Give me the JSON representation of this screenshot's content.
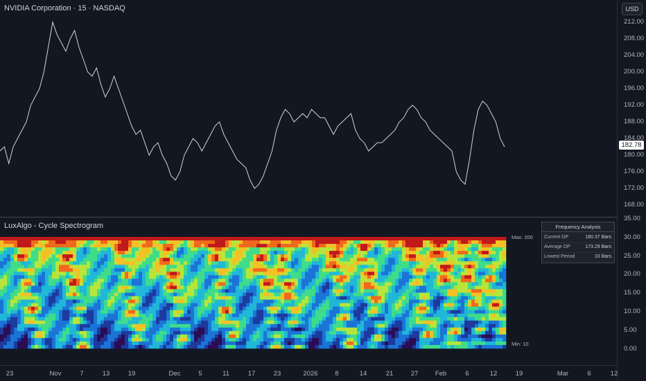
{
  "header": {
    "title": "NVIDIA Corporation · 15 · NASDAQ",
    "currency_button": "USD"
  },
  "price_axis": {
    "ticks": [
      "212.00",
      "208.00",
      "204.00",
      "200.00",
      "196.00",
      "192.00",
      "188.00",
      "184.00",
      "180.00",
      "176.00",
      "172.00",
      "168.00"
    ],
    "last_price": "182.78"
  },
  "indicator": {
    "title": "LuxAlgo - Cycle Spectrogram",
    "max_label": "Max: 200",
    "min_label": "Min: 10",
    "axis_ticks": [
      "35.00",
      "30.00",
      "25.00",
      "20.00",
      "15.00",
      "10.00",
      "5.00",
      "0.00"
    ],
    "table": {
      "title": "Frequency Analysis",
      "rows": [
        {
          "label": "Current DP",
          "value": "180.37 Bars"
        },
        {
          "label": "Average DP",
          "value": "173.29 Bars"
        },
        {
          "label": "Lowest Period",
          "value": "10 Bars"
        }
      ]
    }
  },
  "time_axis": {
    "ticks": [
      "23",
      "Nov",
      "7",
      "13",
      "19",
      "Dec",
      "5",
      "11",
      "17",
      "23",
      "2026",
      "8",
      "14",
      "21",
      "27",
      "Feb",
      "6",
      "12",
      "19",
      "Mar",
      "6",
      "12"
    ]
  },
  "colors": {
    "background": "#131722",
    "price_line": "#d1d4dc",
    "last_price_bg": "#ffffff"
  },
  "chart_data": [
    {
      "type": "line",
      "title": "NVIDIA Corporation · 15 · NASDAQ",
      "x_ticks": [
        "23",
        "Nov",
        "7",
        "13",
        "19",
        "Dec",
        "5",
        "11",
        "17",
        "23",
        "2026",
        "8",
        "14",
        "21",
        "27",
        "Feb",
        "6",
        "12",
        "19",
        "Mar",
        "6",
        "12"
      ],
      "ylim": [
        166,
        215
      ],
      "y_ticks": [
        212,
        208,
        204,
        200,
        196,
        192,
        188,
        184,
        180,
        176,
        172,
        168
      ],
      "last_value": 182.78,
      "grid": false,
      "series": [
        {
          "values": [
            181,
            182,
            178,
            182,
            184,
            186,
            188,
            192,
            194,
            196,
            200,
            206,
            212,
            209,
            207,
            205,
            208,
            210,
            206,
            203,
            200,
            199,
            201,
            197,
            194,
            196,
            199,
            196,
            193,
            190,
            187,
            185,
            186,
            183,
            180,
            182,
            183,
            180,
            178,
            175,
            174,
            176,
            180,
            182,
            184,
            183,
            181,
            183,
            185,
            187,
            188,
            185,
            183,
            181,
            179,
            178,
            177,
            174,
            172,
            173,
            175,
            178,
            181,
            186,
            189,
            191,
            190,
            188,
            189,
            190,
            189,
            191,
            190,
            189,
            189,
            187,
            185,
            187,
            188,
            189,
            190,
            186,
            184,
            183,
            181,
            182,
            183,
            183,
            184,
            185,
            186,
            188,
            189,
            191,
            192,
            191,
            189,
            188,
            186,
            185,
            184,
            183,
            182,
            181,
            176,
            174,
            173,
            179,
            186,
            191,
            193,
            192,
            190,
            188,
            184,
            182
          ]
        }
      ]
    },
    {
      "type": "heatmap",
      "title": "LuxAlgo - Cycle Spectrogram",
      "y_range_labels": [
        "Max: 200",
        "Min: 10"
      ],
      "ylim": [
        0,
        35
      ],
      "y_ticks": [
        35,
        30,
        25,
        20,
        15,
        10,
        5,
        0
      ],
      "value_range": [
        10,
        200
      ],
      "colormap": [
        "#2a0d54",
        "#1d3a9e",
        "#1b74d6",
        "#20b7d8",
        "#3fdc8a",
        "#b8e53b",
        "#f5c026",
        "#f06a1c",
        "#c01a1a"
      ]
    }
  ]
}
